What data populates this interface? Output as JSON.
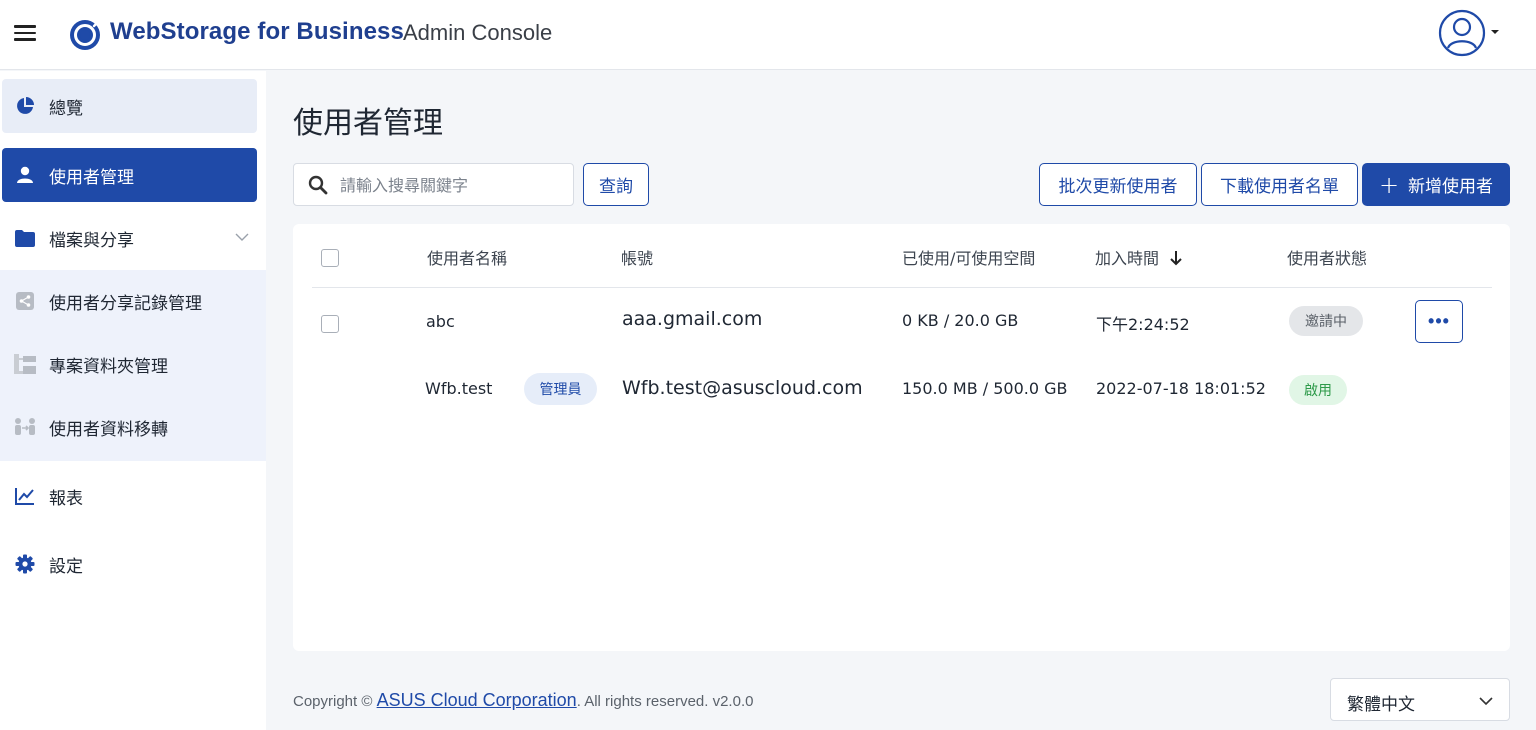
{
  "header": {
    "brand_name": "WebStorage for Business",
    "brand_sub": "Admin Console",
    "icons": {
      "menu": "hamburger-icon",
      "logo": "webstorage-logo",
      "user": "user-avatar-icon",
      "caret": "caret-down-icon"
    }
  },
  "sidebar": {
    "overview": "總覽",
    "user_management": "使用者管理",
    "files_sharing": "檔案與分享",
    "sub_items": [
      "使用者分享記錄管理",
      "專案資料夾管理",
      "使用者資料移轉"
    ],
    "reports": "報表",
    "settings": "設定"
  },
  "main": {
    "title": "使用者管理",
    "search_placeholder": "請輸入搜尋關鍵字",
    "query_label": "查詢",
    "batch_update_label": "批次更新使用者",
    "download_list_label": "下載使用者名單",
    "add_user_label": "新增使用者",
    "table": {
      "columns": [
        "使用者名稱",
        "帳號",
        "已使用/可使用空間",
        "加入時間",
        "使用者狀態"
      ],
      "rows": [
        {
          "name": "abc",
          "account": "aaa.gmail.com",
          "usage": "0 KB / 20.0 GB",
          "joined": "下午2:24:52",
          "status": "邀請中",
          "more": "•••"
        },
        {
          "name": "Wfb.test",
          "badge": "管理員",
          "account": "Wfb.test@asuscloud.com",
          "usage": "150.0 MB / 500.0 GB",
          "joined": "2022-07-18 18:01:52",
          "status": "啟用"
        }
      ]
    }
  },
  "footer": {
    "copyright_prefix": "Copyright © ",
    "company": "ASUS Cloud Corporation",
    "copyright_suffix": ". All rights reserved. v2.0.0",
    "language": "繁體中文"
  },
  "colors": {
    "primary": "#1f4aa8",
    "brand_text": "#1f3f8f",
    "active_status": "#2e9a4a",
    "invite_status_bg": "#e4e6e9"
  }
}
